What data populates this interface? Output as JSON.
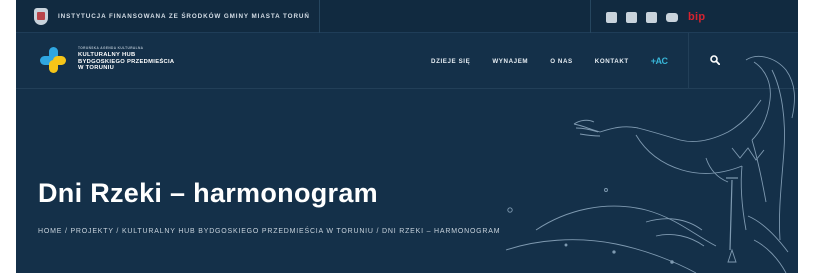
{
  "topbar": {
    "funding_text": "INSTYTUCJA FINANSOWANA ZE ŚRODKÓW GMINY MIASTA TORUŃ",
    "social_icons": [
      "facebook-icon",
      "instagram-icon",
      "flickr-icon",
      "youtube-icon"
    ],
    "bip_label": "bip"
  },
  "logo": {
    "small_line": "TORUŃSKA AGENDA KULTURALNA",
    "lines": [
      "KULTURALNY HUB",
      "BYDGOSKIEGO PRZEDMIEŚCIA",
      "W TORUNIU"
    ]
  },
  "nav": {
    "items": [
      "DZIEJE SIĘ",
      "WYNAJEM",
      "O NAS",
      "KONTAKT"
    ],
    "ac_label": "+AC"
  },
  "hero": {
    "title": "Dni Rzeki – harmonogram",
    "breadcrumb": [
      "HOME",
      "PROJEKTY",
      "KULTURALNY HUB BYDGOSKIEGO PRZEDMIEŚCIA W TORUNIU",
      "DNI RZEKI – HARMONOGRAM"
    ],
    "separator": " / "
  },
  "colors": {
    "background": "#143049",
    "logo_blue": "#2fa6e0",
    "logo_yellow": "#f5c518",
    "accent_cyan": "#38b6d8",
    "bip_red": "#d6232f"
  }
}
